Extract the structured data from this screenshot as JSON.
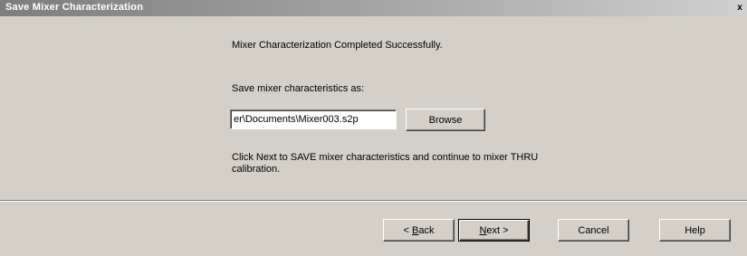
{
  "window": {
    "title": "Save Mixer Characterization",
    "close_glyph": "x"
  },
  "content": {
    "success_message": "Mixer Characterization Completed Successfully.",
    "save_as_label": "Save mixer characteristics as:",
    "file_path_value": "er\\Documents\\Mixer003.s2p",
    "browse_label": "Browse",
    "instructions": "Click Next to SAVE mixer characteristics and continue to mixer THRU calibration."
  },
  "buttons": {
    "back_prefix": "< ",
    "back_mnemonic": "B",
    "back_rest": "ack",
    "next_mnemonic": "N",
    "next_rest": "ext >",
    "cancel_label": "Cancel",
    "help_label": "Help"
  },
  "colors": {
    "face": "#d4d0c8",
    "titlebar_start": "#7d7d7d",
    "titlebar_end": "#d0d0d0"
  },
  "icons": {
    "close": "close-icon"
  }
}
